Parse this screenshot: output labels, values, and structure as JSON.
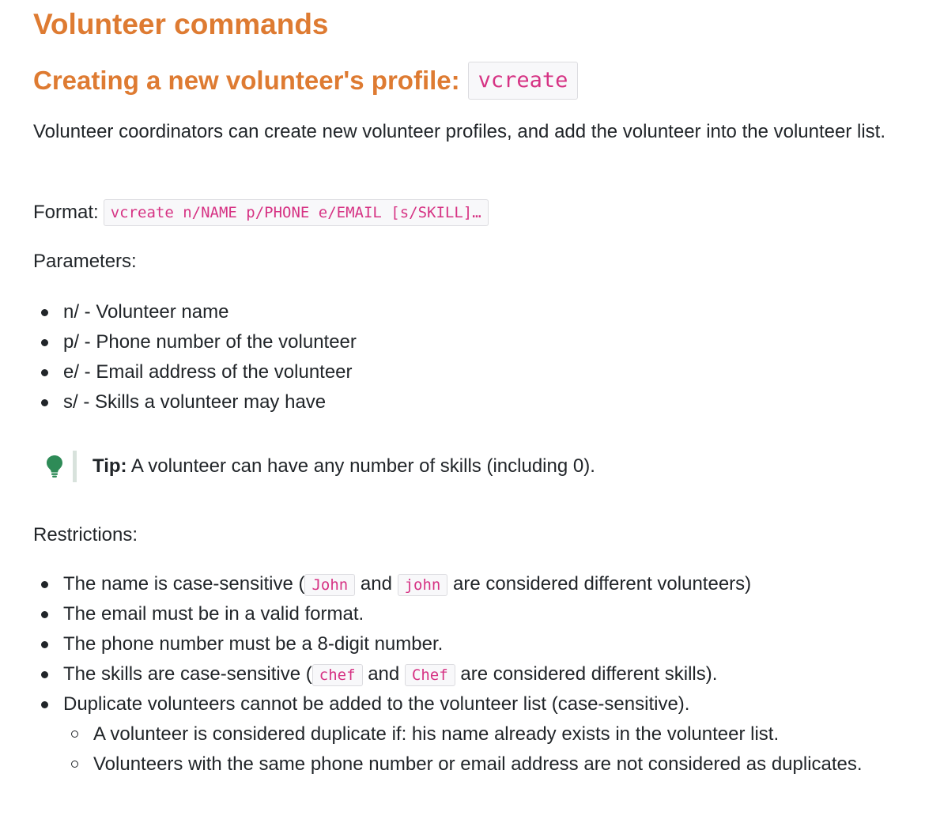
{
  "heading": "Volunteer commands",
  "section": {
    "title": "Creating a new volunteer's profile:",
    "command": "vcreate"
  },
  "intro": "Volunteer coordinators can create new volunteer profiles, and add the volunteer into the volunteer list.",
  "format": {
    "label": "Format:",
    "code": "vcreate n/NAME p/PHONE e/EMAIL [s/SKILL]…"
  },
  "parameters": {
    "label": "Parameters:",
    "items": [
      "n/ - Volunteer name",
      "p/ - Phone number of the volunteer",
      "e/ - Email address of the volunteer",
      "s/ - Skills a volunteer may have"
    ]
  },
  "tip": {
    "icon": "lightbulb-icon",
    "label": "Tip:",
    "text": " A volunteer can have any number of skills (including 0)."
  },
  "restrictions": {
    "label": "Restrictions:",
    "name_rule": {
      "before": "The name is case-sensitive (",
      "code1": "John",
      "middle": " and ",
      "code2": "john",
      "after": " are considered different volunteers)"
    },
    "email_rule": "The email must be in a valid format.",
    "phone_rule": "The phone number must be a 8-digit number.",
    "skills_rule": {
      "before": "The skills are case-sensitive (",
      "code1": "chef",
      "middle": " and ",
      "code2": "Chef",
      "after": " are considered different skills)."
    },
    "duplicate_rule": "Duplicate volunteers cannot be added to the volunteer list (case-sensitive).",
    "sub_items": [
      "A volunteer is considered duplicate if: his name already exists in the volunteer list.",
      "Volunteers with the same phone number or email address are not considered as duplicates."
    ]
  },
  "colors": {
    "heading": "#de7b32",
    "code_text": "#d63384",
    "tip_icon": "#2e8b57"
  }
}
